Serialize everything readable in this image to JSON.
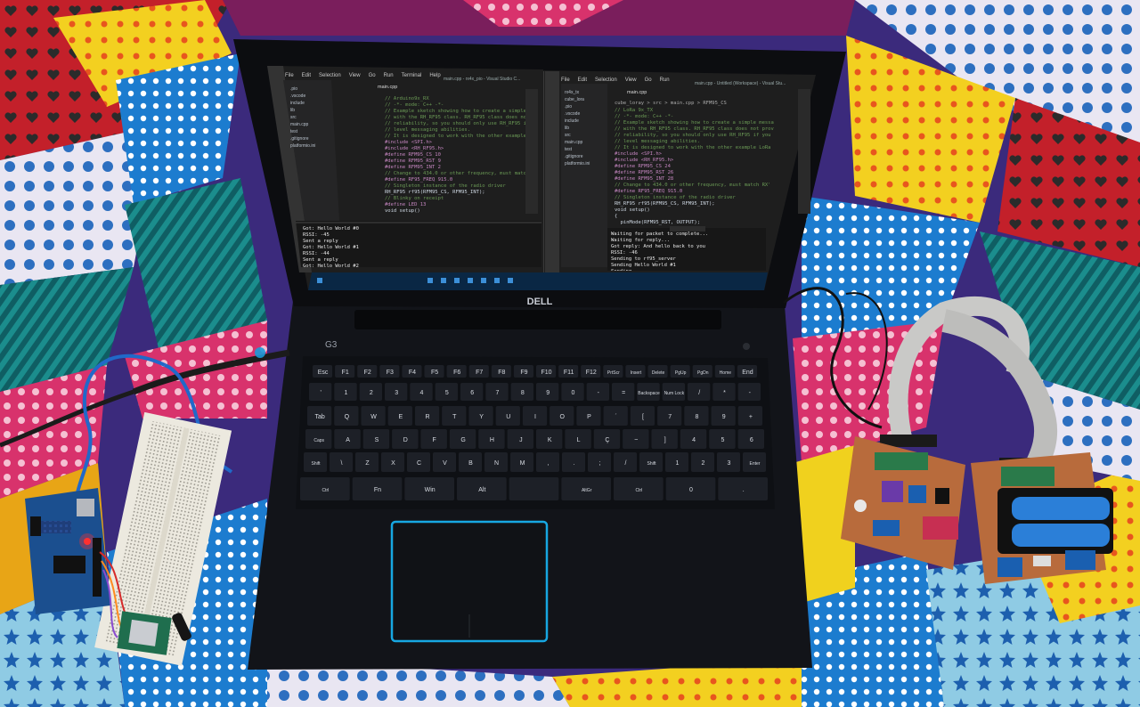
{
  "left_window": {
    "menu": [
      "File",
      "Edit",
      "Selection",
      "View",
      "Go",
      "Run",
      "Terminal",
      "Help"
    ],
    "title": "main.cpp - rx4x_pio - Visual Studio C...",
    "explorer_label": "EXPLORER",
    "open_editors": "OPEN EDITORS",
    "project": "RX4X_PIO",
    "tree": [
      ".pio",
      ".vscode",
      "include",
      "lib",
      "src",
      "main.cpp",
      "test",
      ".gitignore",
      "platformio.ini"
    ],
    "tab": "main.cpp",
    "code": [
      "// Arduino9x_RX",
      "// -*- mode: C++ -*-",
      "// Example sketch showing how to create a simple messag",
      "// with the RH_RF95 class. RH_RF95 class does not provi",
      "// reliability, so you should only use RH_RF95 if you",
      "// level messaging abilities.",
      "// It is designed to work with the other example Ardu",
      "",
      "#include <SPI.h>",
      "#include <RH_RF95.h>",
      "",
      "#define RFM95_CS 10",
      "#define RFM95_RST 9",
      "#define RFM95_INT 2",
      "",
      "// Change to 434.0 or other frequency, must match RX'",
      "#define RF95_FREQ 915.0",
      "",
      "// Singleton instance of the radio driver",
      "RH_RF95 rf95(RFM95_CS, RFM95_INT);",
      "",
      "// Blinky on receipt",
      "#define LED 13",
      "",
      "void setup()"
    ],
    "panel_tab": "TERMINAL",
    "terminal": [
      "Got: Hello World #0",
      "RSSI: -45",
      "Sent a reply",
      "Got: Hello World #1",
      "RSSI: -44",
      "Sent a reply",
      "Got: Hello World #2"
    ],
    "bottom_items": [
      "OUTLINE",
      "TIMELINE"
    ]
  },
  "right_window": {
    "menu": [
      "File",
      "Edit",
      "Selection",
      "View",
      "Go",
      "Run"
    ],
    "title": "main.cpp - Untitled (Workspace) - Visual Stu...",
    "explorer_label": "EXPLORER",
    "open_editors": "OPEN EDITORS",
    "project": "UNTITLED (WORKSPACE)",
    "tree": [
      "rx4x_tx",
      "cube_lora",
      ".pio",
      ".vscode",
      "include",
      "lib",
      "src",
      "main.cpp",
      "test",
      ".gitignore",
      "platformio.ini"
    ],
    "tab": "main.cpp",
    "breadcrumb": "cube_loray > src > main.cpp > RFM95_CS",
    "code": [
      "// LoRa 9x_TX",
      "// -*- mode: C++ -*-",
      "// Example sketch showing how to create a simple messa",
      "// with the RH_RF95 class. RH_RF95 class does not prov",
      "// reliability, so you should only use RH_RF95 if you",
      "// level messaging abilities.",
      "// It is designed to work with the other example LoRa",
      "",
      "#include <SPI.h>",
      "#include <RH_RF95.h>",
      "",
      "#define RFM95_CS 24",
      "#define RFM95_RST 26",
      "#define RFM95_INT 28",
      "",
      "// Change to 434.0 or other frequency, must match RX'",
      "#define RF95_FREQ 915.0",
      "",
      "// Singleton instance of the radio driver",
      "RH_RF95 rf95(RFM95_CS, RFM95_INT);",
      "",
      "void setup()",
      "{",
      "  pinMode(RFM95_RST, OUTPUT);",
      "  digitalWrite(RFM95_RST, HIGH);"
    ],
    "terminal": [
      "Waiting for packet to complete...",
      "Waiting for reply...",
      "Got reply: And hello back to you",
      "RSSI: -46",
      "Sending to rf95_server",
      "Sending Hello World #1",
      "Sending...",
      "Waiting for packet to complete...",
      "Waiting for reply...",
      "Got reply: And hello back to you"
    ]
  },
  "laptop": {
    "brand": "DELL",
    "model": "G3",
    "keys_row1": [
      "Esc",
      "F1",
      "F2",
      "F3",
      "F4",
      "F5",
      "F6",
      "F7",
      "F8",
      "F9",
      "F10",
      "F11",
      "F12",
      "PrtScr",
      "Insert",
      "Delete",
      "PgUp",
      "PgDn",
      "Home",
      "End"
    ],
    "keys_row2": [
      "'",
      "1",
      "2",
      "3",
      "4",
      "5",
      "6",
      "7",
      "8",
      "9",
      "0",
      "-",
      "=",
      "Backspace",
      "Num Lock",
      "/",
      "*",
      "-"
    ],
    "keys_row3": [
      "Tab",
      "Q",
      "W",
      "E",
      "R",
      "T",
      "Y",
      "U",
      "I",
      "O",
      "P",
      "´",
      "[",
      "7",
      "8",
      "9",
      "+"
    ],
    "keys_row4": [
      "Caps",
      "A",
      "S",
      "D",
      "F",
      "G",
      "H",
      "J",
      "K",
      "L",
      "Ç",
      "~",
      "]",
      "4",
      "5",
      "6"
    ],
    "keys_row5": [
      "Shift",
      "\\",
      "Z",
      "X",
      "C",
      "V",
      "B",
      "N",
      "M",
      ",",
      ".",
      ";",
      "/",
      "Shift",
      "1",
      "2",
      "3",
      "Enter"
    ],
    "keys_row6": [
      "Ctrl",
      "Fn",
      "Win",
      "Alt",
      "",
      "AltGr",
      "Ctrl",
      "0",
      "."
    ]
  },
  "colors": {
    "vscode_bg": "#1e1e1e",
    "sidebar_bg": "#252526",
    "accent_blue": "#007acc",
    "laptop_body": "#15181e",
    "touchpad_trim": "#1aa6e0",
    "arduino_blue": "#1b4f8f",
    "breadboard": "#eceae2",
    "pcb": "#b86b3c",
    "battery": "#2b7fd8",
    "ribbon": "#c9c9c7"
  }
}
